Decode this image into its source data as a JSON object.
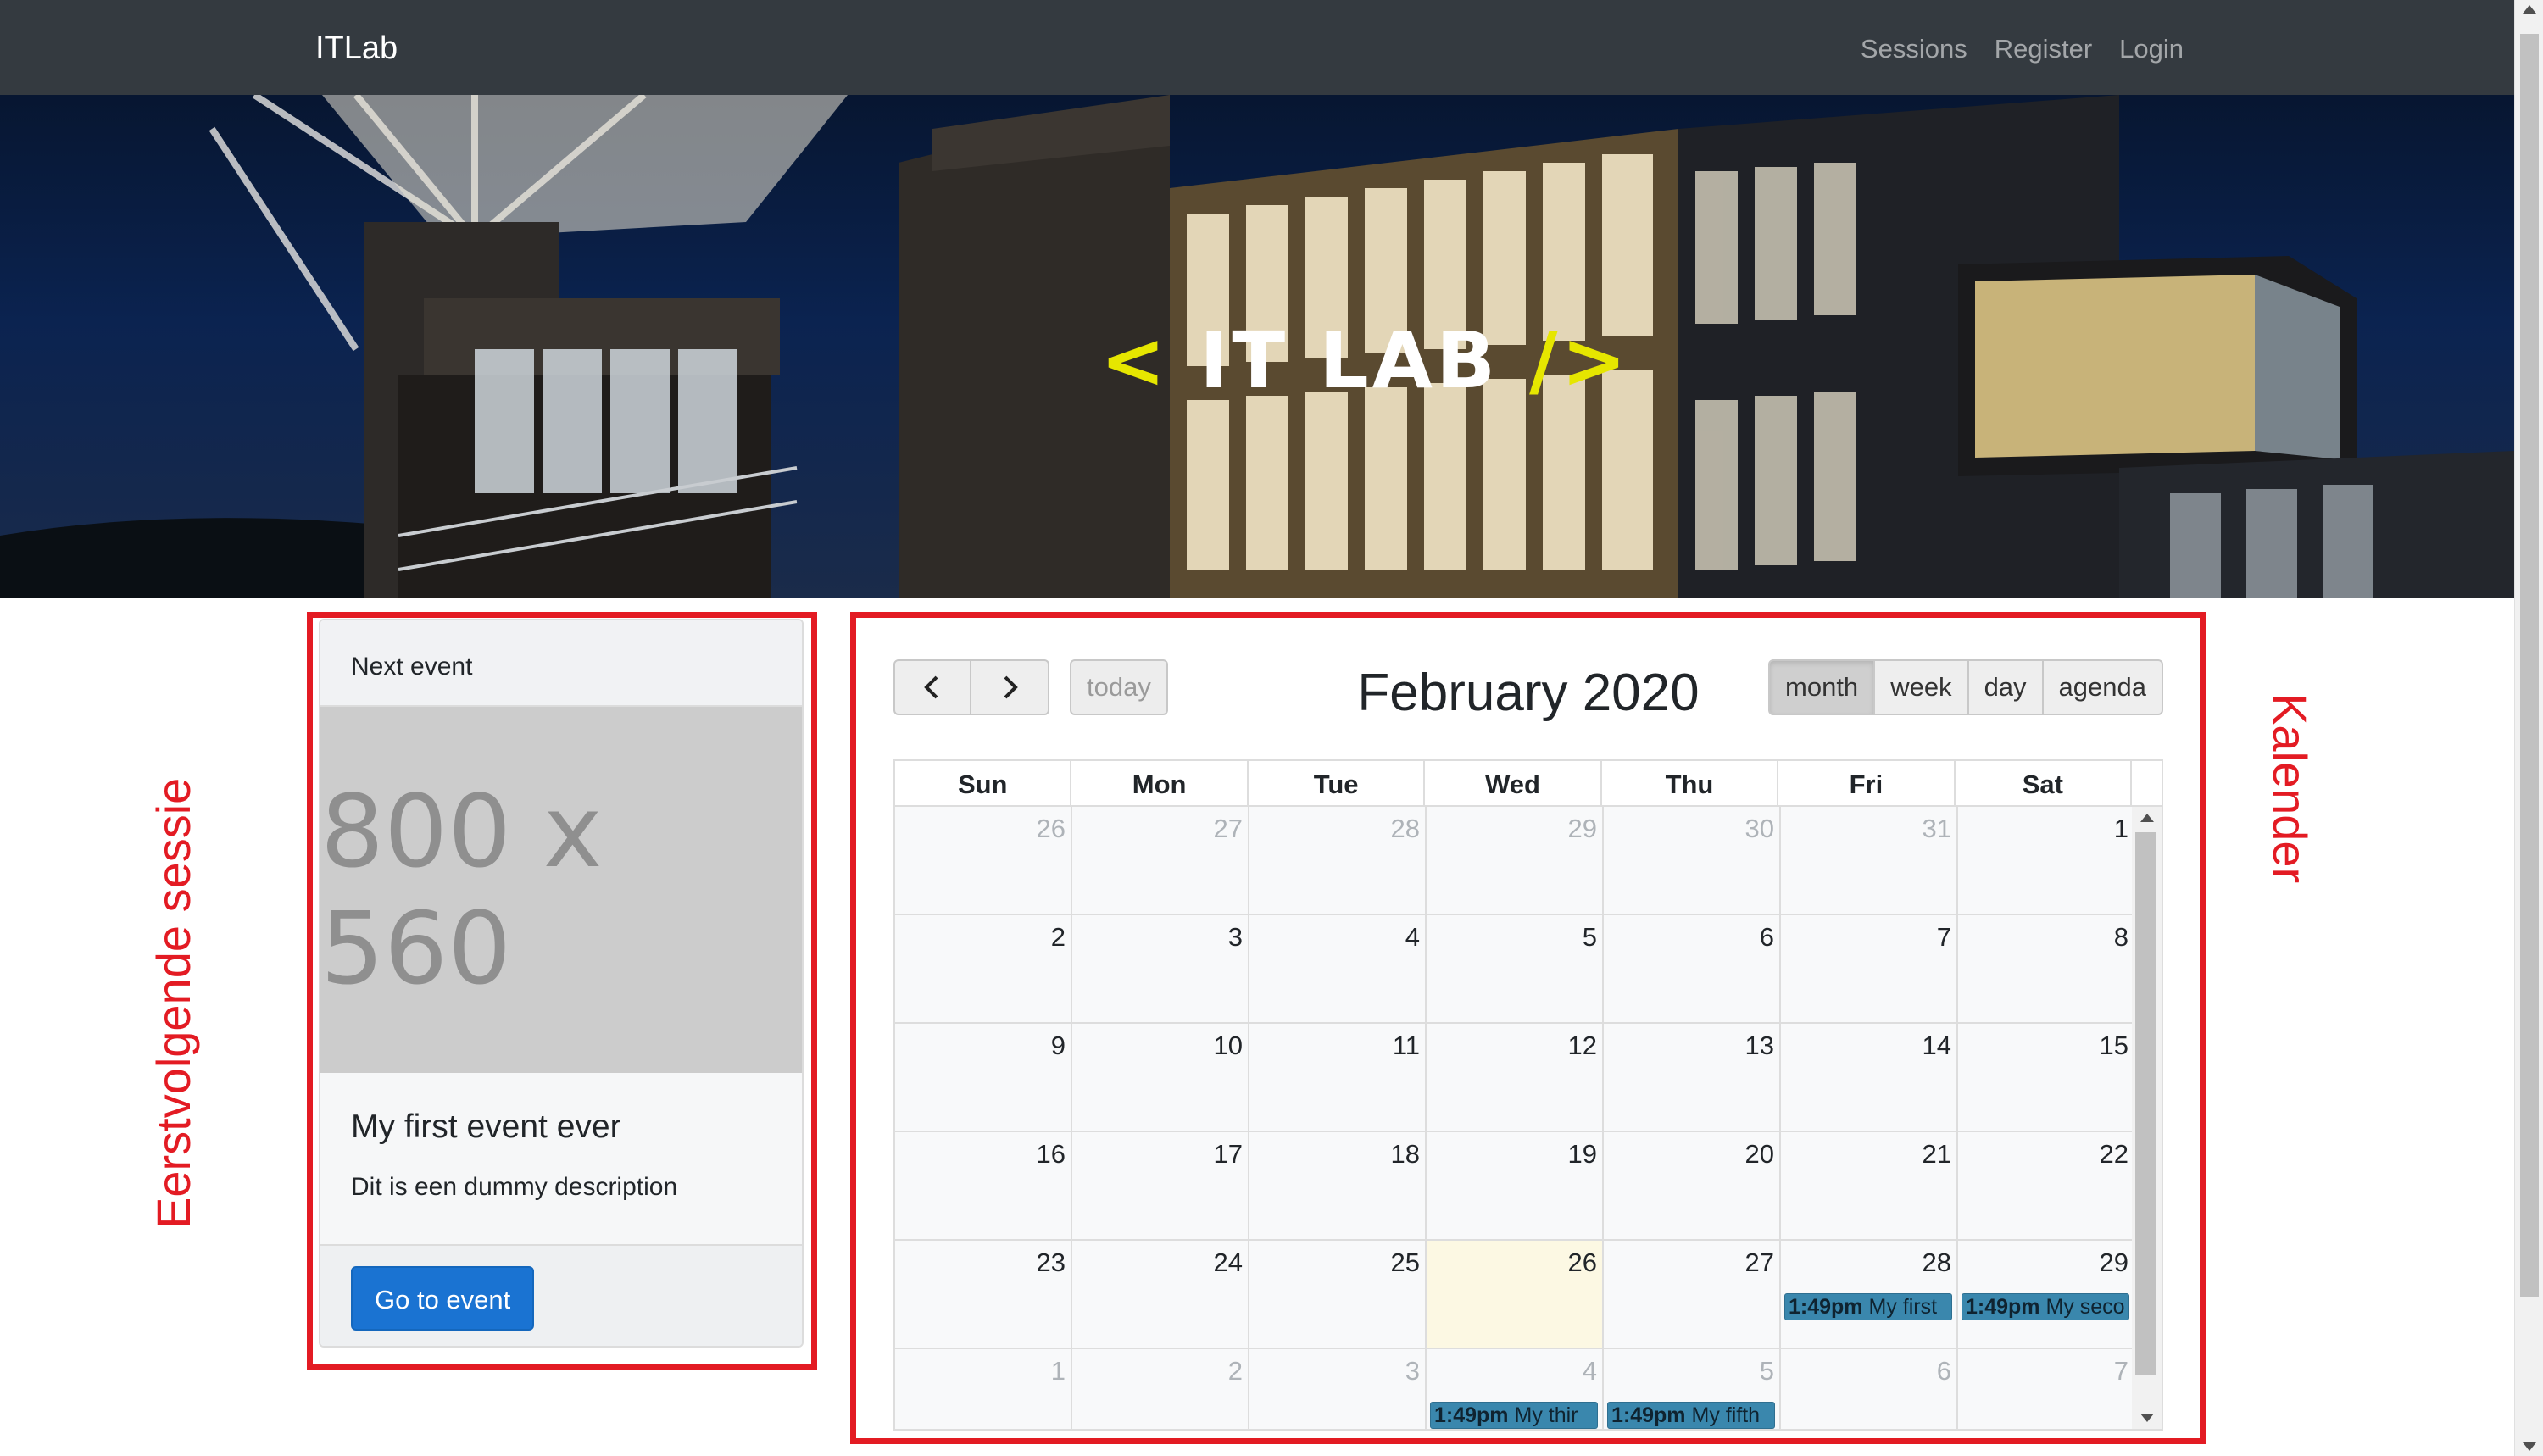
{
  "navbar": {
    "brand": "ITLab",
    "links": [
      "Sessions",
      "Register",
      "Login"
    ]
  },
  "hero": {
    "logo": {
      "open": "<",
      "text": "IT LAB",
      "close": "/>"
    }
  },
  "annotations": {
    "left": "Eerstvolgende sessie",
    "right": "Kalender"
  },
  "card": {
    "header": "Next event",
    "image_placeholder": "800 x 560",
    "title": "My first event ever",
    "description": "Dit is een dummy description",
    "button": "Go to event"
  },
  "calendar": {
    "title": "February 2020",
    "prev_icon": "chevron-left-icon",
    "next_icon": "chevron-right-icon",
    "today": "today",
    "views": [
      "month",
      "week",
      "day",
      "agenda"
    ],
    "active_view": "month",
    "weekdays": [
      "Sun",
      "Mon",
      "Tue",
      "Wed",
      "Thu",
      "Fri",
      "Sat"
    ],
    "weeks": [
      [
        {
          "d": "26",
          "other": true
        },
        {
          "d": "27",
          "other": true
        },
        {
          "d": "28",
          "other": true
        },
        {
          "d": "29",
          "other": true
        },
        {
          "d": "30",
          "other": true
        },
        {
          "d": "31",
          "other": true
        },
        {
          "d": "1"
        }
      ],
      [
        {
          "d": "2"
        },
        {
          "d": "3"
        },
        {
          "d": "4"
        },
        {
          "d": "5"
        },
        {
          "d": "6"
        },
        {
          "d": "7"
        },
        {
          "d": "8"
        }
      ],
      [
        {
          "d": "9"
        },
        {
          "d": "10"
        },
        {
          "d": "11"
        },
        {
          "d": "12"
        },
        {
          "d": "13"
        },
        {
          "d": "14"
        },
        {
          "d": "15"
        }
      ],
      [
        {
          "d": "16"
        },
        {
          "d": "17"
        },
        {
          "d": "18"
        },
        {
          "d": "19"
        },
        {
          "d": "20"
        },
        {
          "d": "21"
        },
        {
          "d": "22"
        }
      ],
      [
        {
          "d": "23"
        },
        {
          "d": "24"
        },
        {
          "d": "25"
        },
        {
          "d": "26",
          "today": true
        },
        {
          "d": "27"
        },
        {
          "d": "28",
          "event": {
            "time": "1:49pm",
            "title": "My first"
          }
        },
        {
          "d": "29",
          "event": {
            "time": "1:49pm",
            "title": "My seco"
          }
        }
      ],
      [
        {
          "d": "1",
          "other": true
        },
        {
          "d": "2",
          "other": true
        },
        {
          "d": "3",
          "other": true
        },
        {
          "d": "4",
          "other": true,
          "event": {
            "time": "1:49pm",
            "title": "My thir"
          }
        },
        {
          "d": "5",
          "other": true,
          "event": {
            "time": "1:49pm",
            "title": "My fifth"
          }
        },
        {
          "d": "6",
          "other": true
        },
        {
          "d": "7",
          "other": true
        }
      ]
    ]
  },
  "colors": {
    "navbar": "#343a40",
    "primary": "#1a73d2",
    "event": "#3a87ad",
    "today": "#fcf8e3",
    "annotation": "#e31b23"
  }
}
